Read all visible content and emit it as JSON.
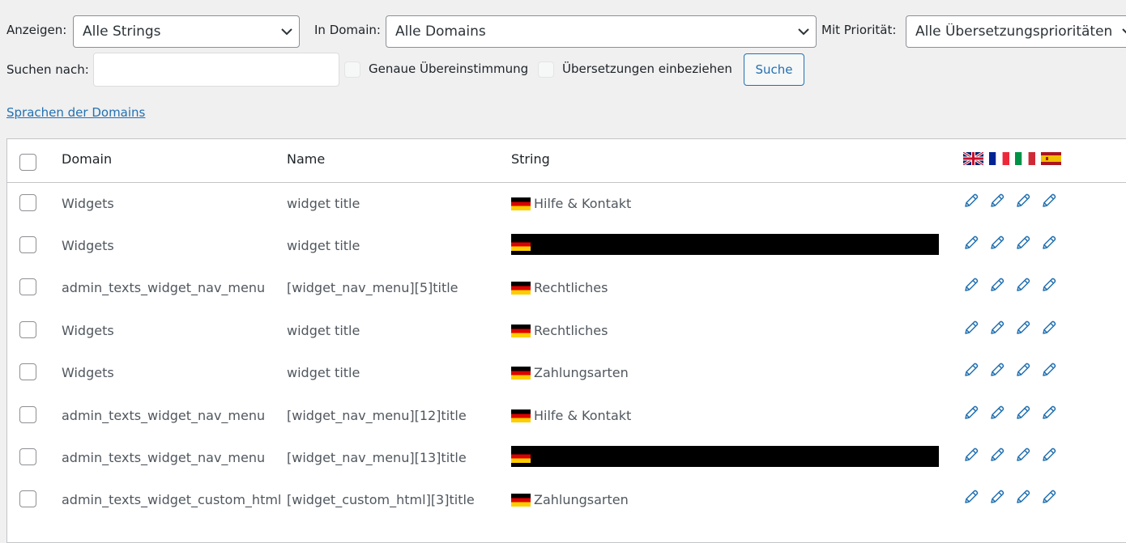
{
  "filters": {
    "show_label": "Anzeigen:",
    "show_value": "Alle Strings",
    "domain_label": "In Domain:",
    "domain_value": "Alle Domains",
    "priority_label": "Mit Priorität:",
    "priority_value": "Alle Übersetzungsprioritäten",
    "search_label": "Suchen nach:",
    "search_value": "",
    "exact_match_label": "Genaue Übereinstimmung",
    "include_translations_label": "Übersetzungen einbeziehen",
    "search_button": "Suche"
  },
  "domain_languages_link": "Sprachen der Domains",
  "table": {
    "columns": {
      "domain": "Domain",
      "name": "Name",
      "string": "String"
    },
    "header_flags": [
      "uk-flag-icon",
      "france-flag-icon",
      "italy-flag-icon",
      "spain-flag-icon"
    ],
    "rows": [
      {
        "domain": "Widgets",
        "name": "widget title",
        "string": "Hilfe & Kontakt"
      },
      {
        "domain": "Widgets",
        "name": "widget title",
        "string": ""
      },
      {
        "domain": "admin_texts_widget_nav_menu",
        "name": "[widget_nav_menu][5]title",
        "string": "Rechtliches"
      },
      {
        "domain": "Widgets",
        "name": "widget title",
        "string": "Rechtliches"
      },
      {
        "domain": "Widgets",
        "name": "widget title",
        "string": "Zahlungsarten"
      },
      {
        "domain": "admin_texts_widget_nav_menu",
        "name": "[widget_nav_menu][12]title",
        "string": "Hilfe & Kontakt"
      },
      {
        "domain": "admin_texts_widget_nav_menu",
        "name": "[widget_nav_menu][13]title",
        "string": ""
      },
      {
        "domain": "admin_texts_widget_custom_html",
        "name": "[widget_custom_html][3]title",
        "string": "Zahlungsarten"
      }
    ]
  },
  "colors": {
    "accent": "#2271b1",
    "background": "#f0f0f1"
  }
}
